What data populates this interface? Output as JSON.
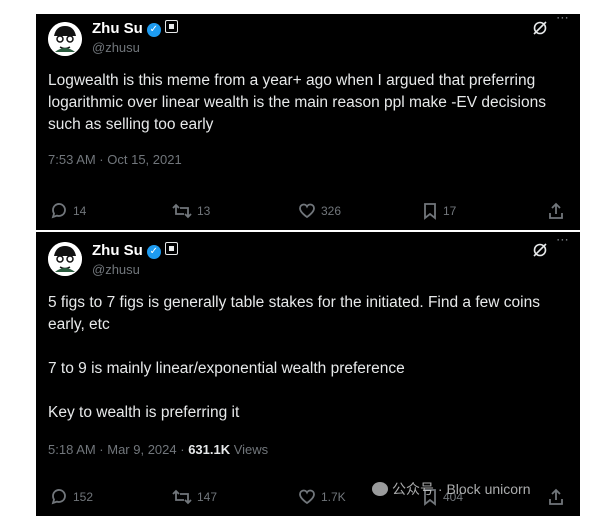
{
  "tweets": [
    {
      "name": "Zhu Su",
      "handle": "@zhusu",
      "text": "Logwealth is this meme from a year+ ago when I argued that preferring logarithmic over linear wealth is the main reason ppl make -EV decisions such as selling too early",
      "timestamp": "7:53 AM · Oct 15, 2021",
      "replies": "14",
      "reposts": "13",
      "likes": "326",
      "bookmarks": "17"
    },
    {
      "name": "Zhu Su",
      "handle": "@zhusu",
      "text": "5 figs to 7 figs is generally table stakes for the initiated. Find a few coins early, etc\n\n7 to 9 is mainly linear/exponential wealth preference\n\nKey to wealth is preferring it",
      "timestamp": "5:18 AM · Mar 9, 2024 · ",
      "views_count": "631.1K",
      "views_label": " Views",
      "replies": "152",
      "reposts": "147",
      "likes": "1.7K",
      "bookmarks": "404"
    }
  ],
  "watermark": "公众号 · Block unicorn",
  "icons": [
    "avatar",
    "verified-badge",
    "square-badge",
    "grok-icon",
    "more-icon",
    "reply-icon",
    "repost-icon",
    "like-icon",
    "bookmark-icon",
    "share-icon"
  ]
}
